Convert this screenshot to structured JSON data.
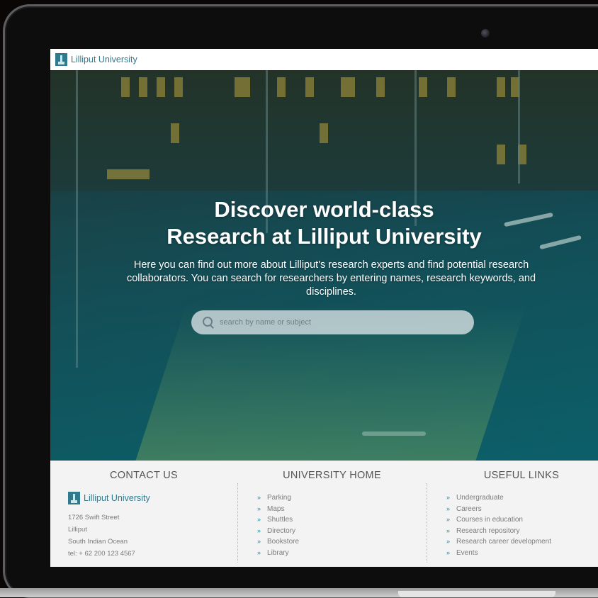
{
  "site": {
    "brand": "Lilliput University"
  },
  "hero": {
    "title_line1": "Discover world-class",
    "title_line2": "Research at Lilliput University",
    "subtitle": "Here you can find out more about Lilliput's research experts and find potential research collaborators. You can search for researchers by entering names, research keywords, and disciplines.",
    "search_placeholder": "search by name or subject"
  },
  "footer": {
    "contact": {
      "heading": "CONTACT US",
      "brand": "Lilliput University",
      "address": [
        "1726 Swift Street",
        "Lilliput",
        "South Indian Ocean",
        "tel: + 62 200 123 4567"
      ]
    },
    "university_home": {
      "heading": "UNIVERSITY HOME",
      "links": [
        "Parking",
        "Maps",
        "Shuttles",
        "Directory",
        "Bookstore",
        "Library"
      ]
    },
    "useful_links": {
      "heading": "USEFUL LINKS",
      "links": [
        "Undergraduate",
        "Careers",
        "Courses in education",
        "Research repository",
        "Research career development",
        "Events"
      ]
    },
    "bullet": "»"
  },
  "colors": {
    "brand": "#2f7a8c",
    "footer_bg": "#f3f3f3",
    "hero_tint": "#0f6a74"
  },
  "icons": {
    "logo": "building-tower-icon",
    "search": "search-icon"
  }
}
